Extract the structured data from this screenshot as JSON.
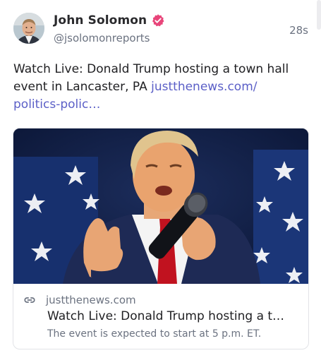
{
  "post": {
    "author": {
      "display_name": "John Solomon",
      "handle": "@jsolomonreports",
      "verified": true
    },
    "timestamp": "28s",
    "text": "Watch Live: Donald Trump hosting a town hall event in Lancaster, PA ",
    "link_text": "justthenews.com/ politics-polic…",
    "link_card": {
      "domain": "justthenews.com",
      "title": "Watch Live: Donald Trump hosting a t…",
      "description": "The event is expected to start at 5 p.m. ET."
    }
  },
  "colors": {
    "link": "#5b5fc7",
    "verified_badge": "#e8457a",
    "muted_text": "#6b7280"
  }
}
